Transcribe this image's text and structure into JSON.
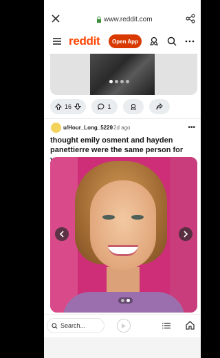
{
  "browser": {
    "url": "www.reddit.com",
    "icons": [
      "close-icon",
      "lock-icon",
      "share-icon"
    ]
  },
  "header": {
    "logo_text": "reddit",
    "open_app_label": "Open App",
    "icons": [
      "menu-icon",
      "award-icon",
      "search-icon",
      "more-icon"
    ],
    "brand_color": "#ff4500",
    "button_color": "#d93a00"
  },
  "post1": {
    "vote_count": "16",
    "comment_count": "1",
    "carousel_pages": 4,
    "carousel_active": 1
  },
  "post2": {
    "username": "u/Hour_Long_5220",
    "time": "• 2d ago",
    "more_label": "•••",
    "title": "thought emily osment and hayden panettierre were the same person for years",
    "carousel_pages": 2,
    "carousel_active": 2
  },
  "bottom": {
    "search_placeholder": "Search..."
  }
}
